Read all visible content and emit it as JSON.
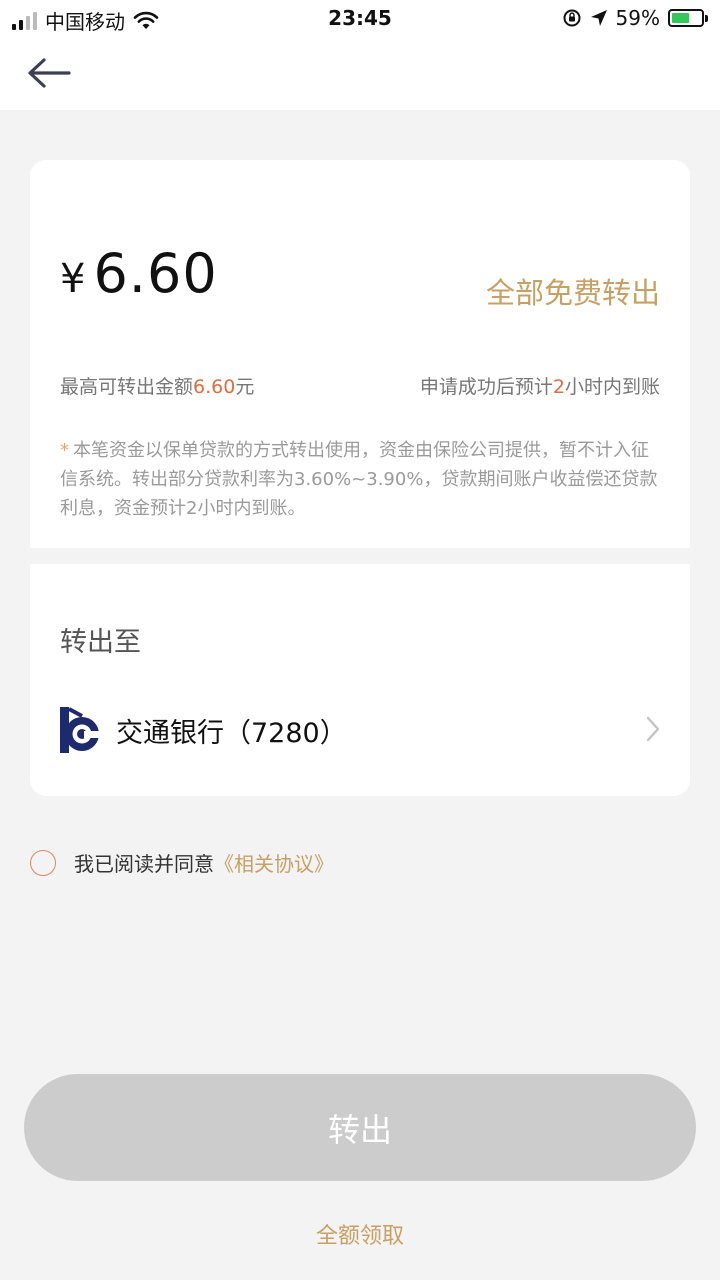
{
  "status_bar": {
    "carrier": "中国移动",
    "time": "23:45",
    "battery_percent": "59%",
    "battery_level": 0.59,
    "signal_bars": 2,
    "signal_max": 4
  },
  "header": {
    "back_icon": "arrow-left-icon"
  },
  "amount_card": {
    "currency_symbol": "¥",
    "amount": "6.60",
    "transfer_all_label": "全部免费转出",
    "max_label": "最高可转出金额",
    "max_value": "6.60",
    "max_unit": "元",
    "eta_prefix": "申请成功后预计",
    "eta_value": "2",
    "eta_suffix": "小时内到账",
    "notice_star": "*",
    "notice_text": "本笔资金以保单贷款的方式转出使用，资金由保险公司提供，暂不计入征信系统。转出部分贷款利率为3.60%~3.90%，贷款期间账户收益偿还贷款利息，资金预计2小时内到账。"
  },
  "destination": {
    "label": "转出至",
    "bank_name": "交通银行（7280）",
    "bank_icon": "bank-of-communications-logo",
    "chevron_icon": "chevron-right-icon"
  },
  "agreement": {
    "text": "我已阅读并同意",
    "link": "《相关协议》",
    "checked": false
  },
  "actions": {
    "submit_label": "转出",
    "full_claim_label": "全额领取"
  },
  "colors": {
    "accent_gold": "#c7a064",
    "highlight_orange": "#e56a3d",
    "button_disabled": "#cccccc",
    "battery_green": "#34c759"
  }
}
